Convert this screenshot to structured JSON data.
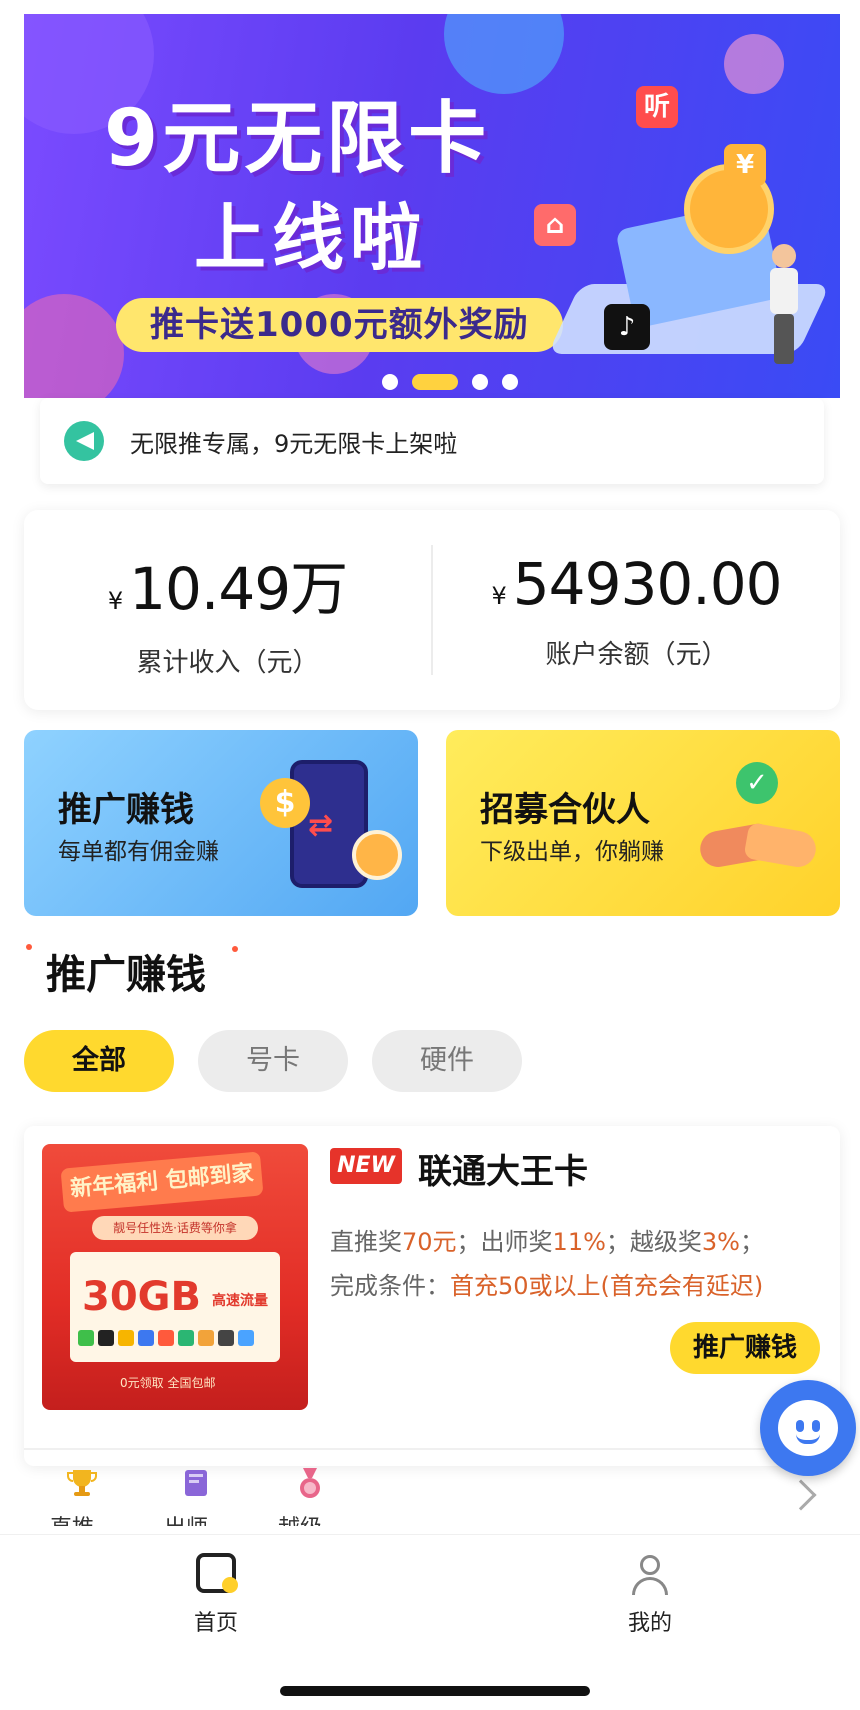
{
  "banner": {
    "title_line1": "9元无限卡",
    "title_line2": "上线啦",
    "subtitle": "推卡送1000元额外奖励",
    "app_icons": [
      "tiktok-icon",
      "listen-icon",
      "phone-card-icon"
    ],
    "app_icon_text": "听"
  },
  "notice": {
    "icon": "megaphone-icon",
    "text": "无限推专属，9元无限卡上架啦"
  },
  "stats": {
    "income": {
      "currency": "¥",
      "value": "10.49万",
      "label": "累计收入（元）"
    },
    "balance": {
      "currency": "¥",
      "value": "54930.00",
      "label": "账户余额（元）"
    }
  },
  "promo_cards": [
    {
      "title": "推广赚钱",
      "subtitle": "每单都有佣金赚",
      "color": "#52a7f3"
    },
    {
      "title": "招募合伙人",
      "subtitle": "下级出单，你躺赚",
      "color": "#ffd22b"
    }
  ],
  "section": {
    "title": "推广赚钱"
  },
  "filter_tabs": [
    {
      "label": "全部",
      "active": true
    },
    {
      "label": "号卡",
      "active": false
    },
    {
      "label": "硬件",
      "active": false
    }
  ],
  "product": {
    "tag": "NEW",
    "name": "联通大王卡",
    "line1_parts": [
      "直推奖",
      "70元",
      "；出师奖",
      "11%",
      "；越级奖",
      "3%",
      "；"
    ],
    "line2_label": "完成条件：",
    "line2_value": "首充50或以上(首充会有延迟)",
    "button": "推广赚钱",
    "image": {
      "ribbon": "新年福利 包邮到家",
      "pill": "靓号任性选·话费等你拿",
      "data": "30GB",
      "data_sub": "高速流量",
      "bottom": "0元领取  全国包邮"
    }
  },
  "rewards": [
    {
      "label": "直推奖",
      "icon": "trophy-icon"
    },
    {
      "label": "出师奖",
      "icon": "book-icon"
    },
    {
      "label": "越级奖",
      "icon": "medal-icon"
    }
  ],
  "bottom_nav": [
    {
      "label": "首页",
      "icon": "home-icon",
      "active": true
    },
    {
      "label": "我的",
      "icon": "user-icon",
      "active": false
    }
  ],
  "colors": {
    "accent_yellow": "#ffd92e",
    "highlight_orange": "#d9622a",
    "banner_purple": "#5b3cf0"
  }
}
